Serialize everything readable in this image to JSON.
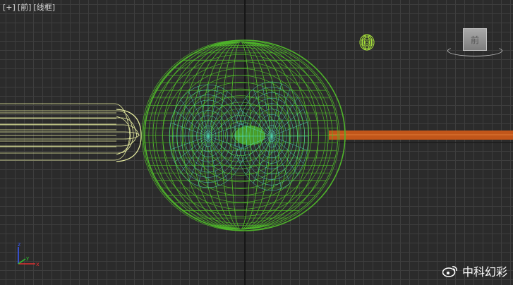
{
  "viewport": {
    "labels": [
      "[+]",
      "[前]",
      "[线框]"
    ]
  },
  "viewcube": {
    "face_label": "前"
  },
  "axis_gizmo": {
    "x": "x",
    "y": "y",
    "z": "z"
  },
  "watermark": {
    "icon": "weibo-icon",
    "text": "中科幻彩"
  },
  "colors": {
    "background": "#2b2b2b",
    "grid": "#3e3e3e",
    "axis_line": "#000000",
    "wire_green": "#4fb52a",
    "wire_cyan": "#4fd3b1",
    "wire_yellow": "#e8eda0",
    "bar_orange": "#c2561a"
  }
}
